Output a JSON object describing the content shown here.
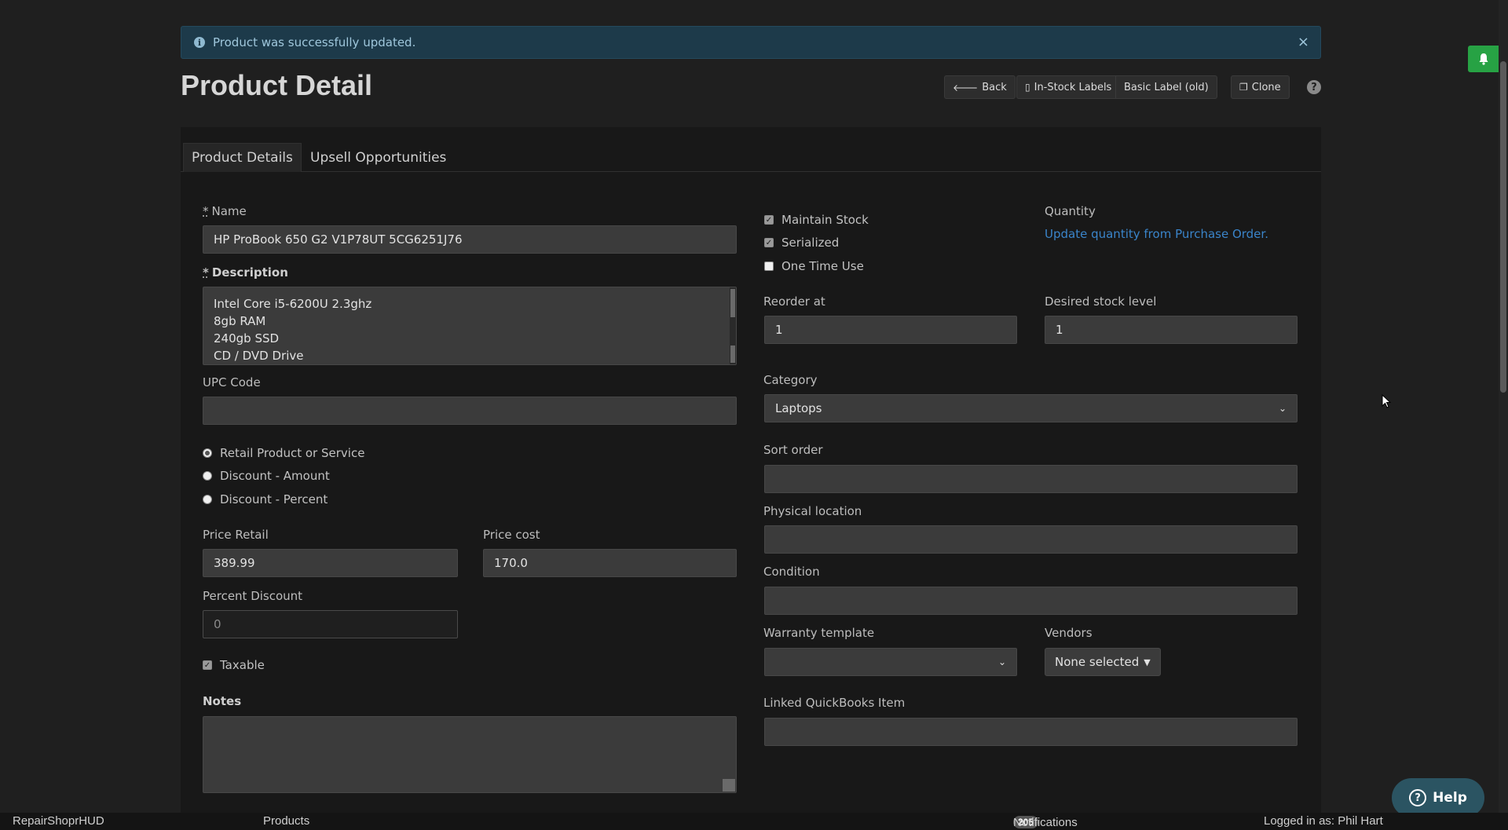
{
  "alert": {
    "message": "Product was successfully updated.",
    "close": "×",
    "icon": "info-icon"
  },
  "page_title": "Product Detail",
  "toolbar": {
    "back": "Back",
    "in_stock_labels": "In-Stock Labels",
    "basic_label": "Basic Label (old)",
    "clone": "Clone",
    "help": "?"
  },
  "tabs": [
    {
      "label": "Product Details",
      "active": true
    },
    {
      "label": "Upsell Opportunities",
      "active": false
    }
  ],
  "form": {
    "required_mark": "*",
    "name_label": "Name",
    "name_value": "HP ProBook 650 G2 V1P78UT 5CG6251J76",
    "description_label": "Description",
    "description_lines": [
      "Intel Core i5-6200U 2.3ghz",
      "8gb RAM",
      "240gb SSD",
      "CD / DVD Drive"
    ],
    "upc_label": "UPC Code",
    "upc_value": "",
    "product_types": [
      {
        "label": "Retail Product or Service",
        "selected": true
      },
      {
        "label": "Discount - Amount",
        "selected": false
      },
      {
        "label": "Discount - Percent",
        "selected": false
      }
    ],
    "price_retail_label": "Price Retail",
    "price_retail_value": "389.99",
    "price_cost_label": "Price cost",
    "price_cost_value": "170.0",
    "percent_discount_label": "Percent Discount",
    "percent_discount_placeholder": "0",
    "taxable_label": "Taxable",
    "taxable_checked": true,
    "notes_label": "Notes",
    "notes_value": "",
    "maintain_stock_label": "Maintain Stock",
    "serialized_label": "Serialized",
    "one_time_use_label": "One Time Use",
    "quantity_label": "Quantity",
    "quantity_link": "Update quantity from Purchase Order.",
    "reorder_label": "Reorder at",
    "reorder_value": "1",
    "desired_stock_label": "Desired stock level",
    "desired_stock_value": "1",
    "category_label": "Category",
    "category_value": "Laptops",
    "sort_order_label": "Sort order",
    "physical_location_label": "Physical location",
    "condition_label": "Condition",
    "warranty_label": "Warranty template",
    "warranty_value": "",
    "vendors_label": "Vendors",
    "vendors_value": "None selected",
    "quickbooks_label": "Linked QuickBooks Item"
  },
  "help_button": "Help",
  "footer": {
    "app_name": "RepairShoprHUD",
    "section": "Products",
    "notification_count": "205",
    "notifications_label": "Notifications",
    "logged_in": "Logged in as: Phil Hart"
  }
}
